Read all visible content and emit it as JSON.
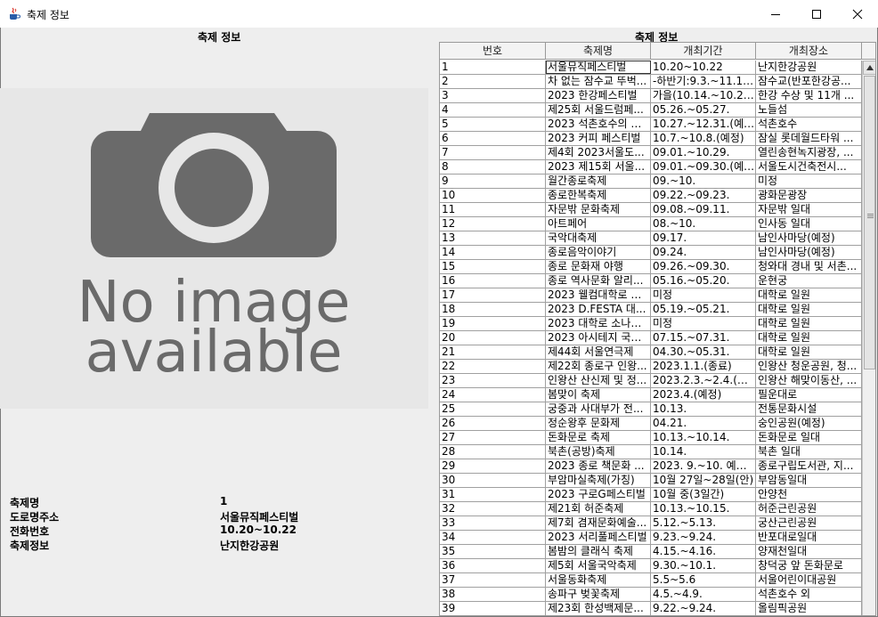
{
  "window": {
    "title": "축제 정보"
  },
  "left_panel": {
    "title": "축제 정보",
    "image": {
      "line1": "No image",
      "line2": "available"
    },
    "fields": [
      {
        "label": "축제명",
        "value": "1"
      },
      {
        "label": "도로명주소",
        "value": "서울뮤직페스티벌"
      },
      {
        "label": "전화번호",
        "value": "10.20~10.22"
      },
      {
        "label": "축제정보",
        "value": "난지한강공원"
      }
    ]
  },
  "right_panel": {
    "title": "축제 정보",
    "columns": [
      "번호",
      "축제명",
      "개최기간",
      "개최장소"
    ],
    "rows": [
      [
        "1",
        "서울뮤직페스티벌",
        "10.20~10.22",
        "난지한강공원"
      ],
      [
        "2",
        "차 없는 잠수교 뚜벅...",
        "-하반기:9.3.~11.12. ...",
        "잠수교(반포한강공..."
      ],
      [
        "3",
        "2023 한강페스티벌",
        "가을(10.14.~10.21.)...",
        "한강 수상 및 11개 ..."
      ],
      [
        "4",
        "제25회 서울드럼페...",
        "05.26.~05.27.",
        "노들섬"
      ],
      [
        "5",
        "2023 석촌호수의 가...",
        "10.27.~12.31.(예정)",
        "석촌호수"
      ],
      [
        "6",
        "2023 커피 페스티벌",
        "10.7.~10.8.(예정)",
        "잠실 롯데월드타워 ..."
      ],
      [
        "7",
        "제4회 2023서울도...",
        "09.01.~10.29.",
        "열린송현녹지광장, ..."
      ],
      [
        "8",
        " 2023 제15회 서울...",
        "09.01.~09.30.(예정)",
        "서울도시건축전시..."
      ],
      [
        "9",
        "월간종로축제",
        "09.~10.",
        "미정"
      ],
      [
        "10",
        "종로한복축제",
        "09.22.~09.23.",
        "광화문광장"
      ],
      [
        "11",
        "자문밖 문화축제",
        "09.08.~09.11.",
        "자문밖 일대"
      ],
      [
        "12",
        " 아트페어",
        "08.~10.",
        "인사동 일대"
      ],
      [
        "13",
        "국악대축제",
        "09.17.",
        "남인사마당(예정)"
      ],
      [
        "14",
        "종로음악이야기",
        "09.24.",
        "남인사마당(예정)"
      ],
      [
        "15",
        "종로 문화재 야행",
        "09.26.~09.30.",
        "청와대 경내 및 서촌..."
      ],
      [
        "16",
        "종로 역사문화 알리...",
        "05.16.~05.20.",
        "운현궁"
      ],
      [
        "17",
        "2023 웰컴대학로 축...",
        "미정",
        "대학로 일원"
      ],
      [
        "18",
        "2023 D.FESTA 대...",
        "05.19.~05.21.",
        "대학로 일원"
      ],
      [
        "19",
        "2023 대학로 소나무...",
        "미정",
        "대학로 일원"
      ],
      [
        "20",
        "2023 아시테지 국제...",
        "07.15.~07.31.",
        "대학로 일원"
      ],
      [
        "21",
        "제44회 서울연극제",
        "04.30.~05.31.",
        "대학로 일원"
      ],
      [
        "22",
        "제22회 종로구 인왕...",
        "2023.1.1.(종료)",
        "인왕산 청운공원, 청..."
      ],
      [
        "23",
        "인왕산 산신제 및 정...",
        "2023.2.3.~2.4.(예정)",
        "인왕산 해맞이동산, ..."
      ],
      [
        "24",
        "봄맞이 축제",
        "2023.4.(예정)",
        "필운대로"
      ],
      [
        "25",
        "궁중과 사대부가 전...",
        "10.13.",
        "전통문화시설"
      ],
      [
        "26",
        "정순왕후 문화제",
        "04.21.",
        "숭인공원(예정)"
      ],
      [
        "27",
        "돈화문로 축제",
        "10.13.~10.14.",
        "돈화문로 일대"
      ],
      [
        "28",
        "북촌(공방)축제",
        "10.14.",
        "북촌 일대"
      ],
      [
        "29",
        "2023 종로 책문화 ...",
        "2023. 9.~10. 예정(...",
        "종로구립도서관, 지..."
      ],
      [
        "30",
        "부암마실축제(가칭)",
        "10월 27일~28일(안)",
        "부암동일대"
      ],
      [
        "31",
        "2023 구로G페스티벌",
        "10월 중(3일간)",
        "안양천"
      ],
      [
        "32",
        "제21회 허준축제",
        "10.13.~10.15.",
        "허준근린공원"
      ],
      [
        "33",
        "제7회 겸재문화예술...",
        "5.12.~5.13.",
        "궁산근린공원"
      ],
      [
        "34",
        "2023 서리풀페스티벌",
        "9.23.~9.24.",
        "반포대로일대"
      ],
      [
        "35",
        "봄밤의 클래식 축제",
        "4.15.~4.16.",
        "양재천일대"
      ],
      [
        "36",
        "제5회 서울국악축제",
        "9.30.~10.1.",
        "창덕궁 앞 돈화문로"
      ],
      [
        "37",
        "서울동화축제",
        "5.5~5.6",
        "서울어린이대공원"
      ],
      [
        "38",
        "송파구 벚꽃축제",
        "4.5.~4.9.",
        "석촌호수 외"
      ],
      [
        "39",
        "제23회 한성백제문...",
        "9.22.~9.24.",
        "올림픽공원"
      ]
    ]
  },
  "icons": {
    "app": "java-cup-icon",
    "minimize": "minimize-icon",
    "maximize": "maximize-icon",
    "close": "close-icon"
  }
}
